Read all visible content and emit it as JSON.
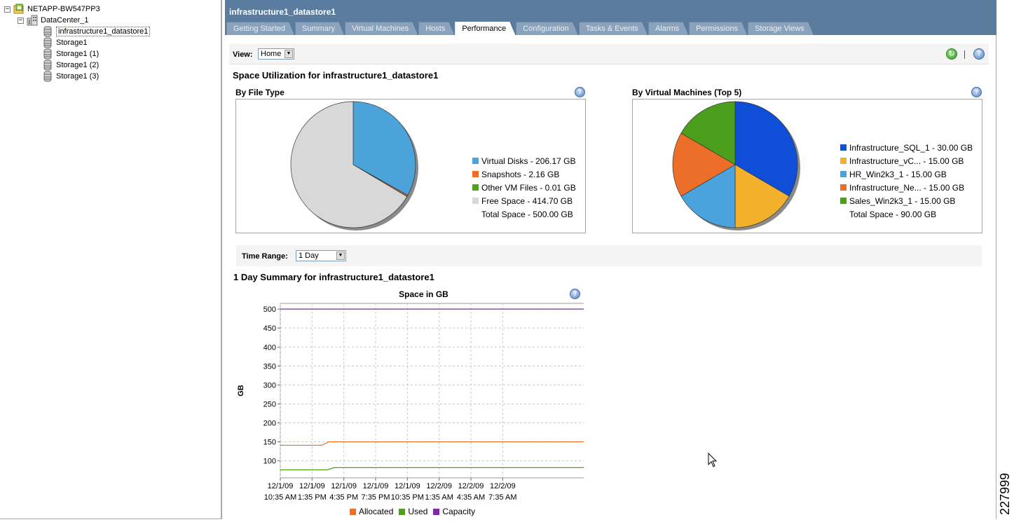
{
  "tree": {
    "root": "NETAPP-BW547PP3",
    "datacenter": "DataCenter_1",
    "items": [
      {
        "label": "infrastructure1_datastore1",
        "selected": true
      },
      {
        "label": "Storage1"
      },
      {
        "label": "Storage1 (1)"
      },
      {
        "label": "Storage1 (2)"
      },
      {
        "label": "Storage1 (3)"
      }
    ]
  },
  "header": {
    "title": "infrastructure1_datastore1",
    "tabs": [
      "Getting Started",
      "Summary",
      "Virtual Machines",
      "Hosts",
      "Performance",
      "Configuration",
      "Tasks & Events",
      "Alarms",
      "Permissions",
      "Storage Views"
    ],
    "active_tab": "Performance"
  },
  "view": {
    "label": "View:",
    "value": "Home"
  },
  "space": {
    "title": "Space Utilization for infrastructure1_datastore1",
    "by_file_type": {
      "title": "By File Type",
      "legend": [
        "Virtual Disks - 206.17 GB",
        "Snapshots - 2.16 GB",
        "Other VM Files - 0.01 GB",
        "Free Space - 414.70 GB"
      ],
      "total": "Total Space - 500.00 GB"
    },
    "by_vm": {
      "title": "By Virtual Machines (Top 5)",
      "legend": [
        "Infrastructure_SQL_1 - 30.00 GB",
        "Infrastructure_vC... - 15.00 GB",
        "HR_Win2k3_1 - 15.00 GB",
        "Infrastructure_Ne... - 15.00 GB",
        "Sales_Win2k3_1 - 15.00 GB"
      ],
      "total": "Total Space - 90.00 GB"
    }
  },
  "time_range": {
    "label": "Time Range:",
    "value": "1 Day"
  },
  "summary": {
    "title": "1 Day Summary for infrastructure1_datastore1"
  },
  "figure_id": "227999",
  "colors": {
    "header_bg": "#5a7c9f",
    "blue": "#4ba3da",
    "orange": "#ef6e24",
    "green": "#4ea21b",
    "grey": "#d8d8d8",
    "vm_blue": "#0f4fd8",
    "vm_yellow": "#f2b02b",
    "vm_lightblue": "#4aa3dd",
    "vm_orange": "#ed6e28",
    "vm_green": "#4b9f1c",
    "capacity": "#7a2aa8"
  },
  "chart_data": [
    {
      "type": "pie",
      "title": "By File Type",
      "labels": [
        "Virtual Disks",
        "Snapshots",
        "Other VM Files",
        "Free Space"
      ],
      "values": [
        206.17,
        2.16,
        0.01,
        414.7
      ],
      "colors": [
        "#4ba3da",
        "#ef6e24",
        "#4ea21b",
        "#d8d8d8"
      ],
      "unit": "GB"
    },
    {
      "type": "pie",
      "title": "By Virtual Machines (Top 5)",
      "labels": [
        "Infrastructure_SQL_1",
        "Infrastructure_vC...",
        "HR_Win2k3_1",
        "Infrastructure_Ne...",
        "Sales_Win2k3_1"
      ],
      "values": [
        30,
        15,
        15,
        15,
        15
      ],
      "colors": [
        "#0f4fd8",
        "#f2b02b",
        "#4aa3dd",
        "#ed6e28",
        "#4b9f1c"
      ],
      "unit": "GB"
    },
    {
      "type": "line",
      "title": "Space in GB",
      "ylabel": "GB",
      "xlabel": "",
      "ylim": [
        55,
        515
      ],
      "yticks": [
        100,
        150,
        200,
        250,
        300,
        350,
        400,
        450,
        500
      ],
      "xlim": [
        "12/1/09 10:35 AM",
        "12/2/09 3:30 PM"
      ],
      "xticks": [
        [
          "12/1/09",
          "10:35 AM"
        ],
        [
          "12/1/09",
          "1:35 PM"
        ],
        [
          "12/1/09",
          "4:35 PM"
        ],
        [
          "12/1/09",
          "7:35 PM"
        ],
        [
          "12/1/09",
          "10:35 PM"
        ],
        [
          "12/2/09",
          "1:35 AM"
        ],
        [
          "12/2/09",
          "4:35 AM"
        ],
        [
          "12/2/09",
          "7:35 AM"
        ]
      ],
      "grid": true,
      "series": [
        {
          "name": "Allocated",
          "color": "#ef6e24",
          "points": [
            [
              "12/1/09 10:35 AM",
              141
            ],
            [
              "12/1/09 2:30 PM",
              141
            ],
            [
              "12/1/09 3:10 PM",
              150
            ],
            [
              "12/2/09 3:30 PM",
              150
            ]
          ]
        },
        {
          "name": "Used",
          "color": "#4ea21b",
          "points": [
            [
              "12/1/09 10:35 AM",
              76
            ],
            [
              "12/1/09 3:00 PM",
              76
            ],
            [
              "12/1/09 3:40 PM",
              82
            ],
            [
              "12/2/09 3:30 PM",
              82
            ]
          ]
        },
        {
          "name": "Capacity",
          "color": "#7a2aa8",
          "points": [
            [
              "12/1/09 10:35 AM",
              500
            ],
            [
              "12/2/09 3:30 PM",
              500
            ]
          ]
        }
      ],
      "legend_position": "bottom"
    }
  ]
}
